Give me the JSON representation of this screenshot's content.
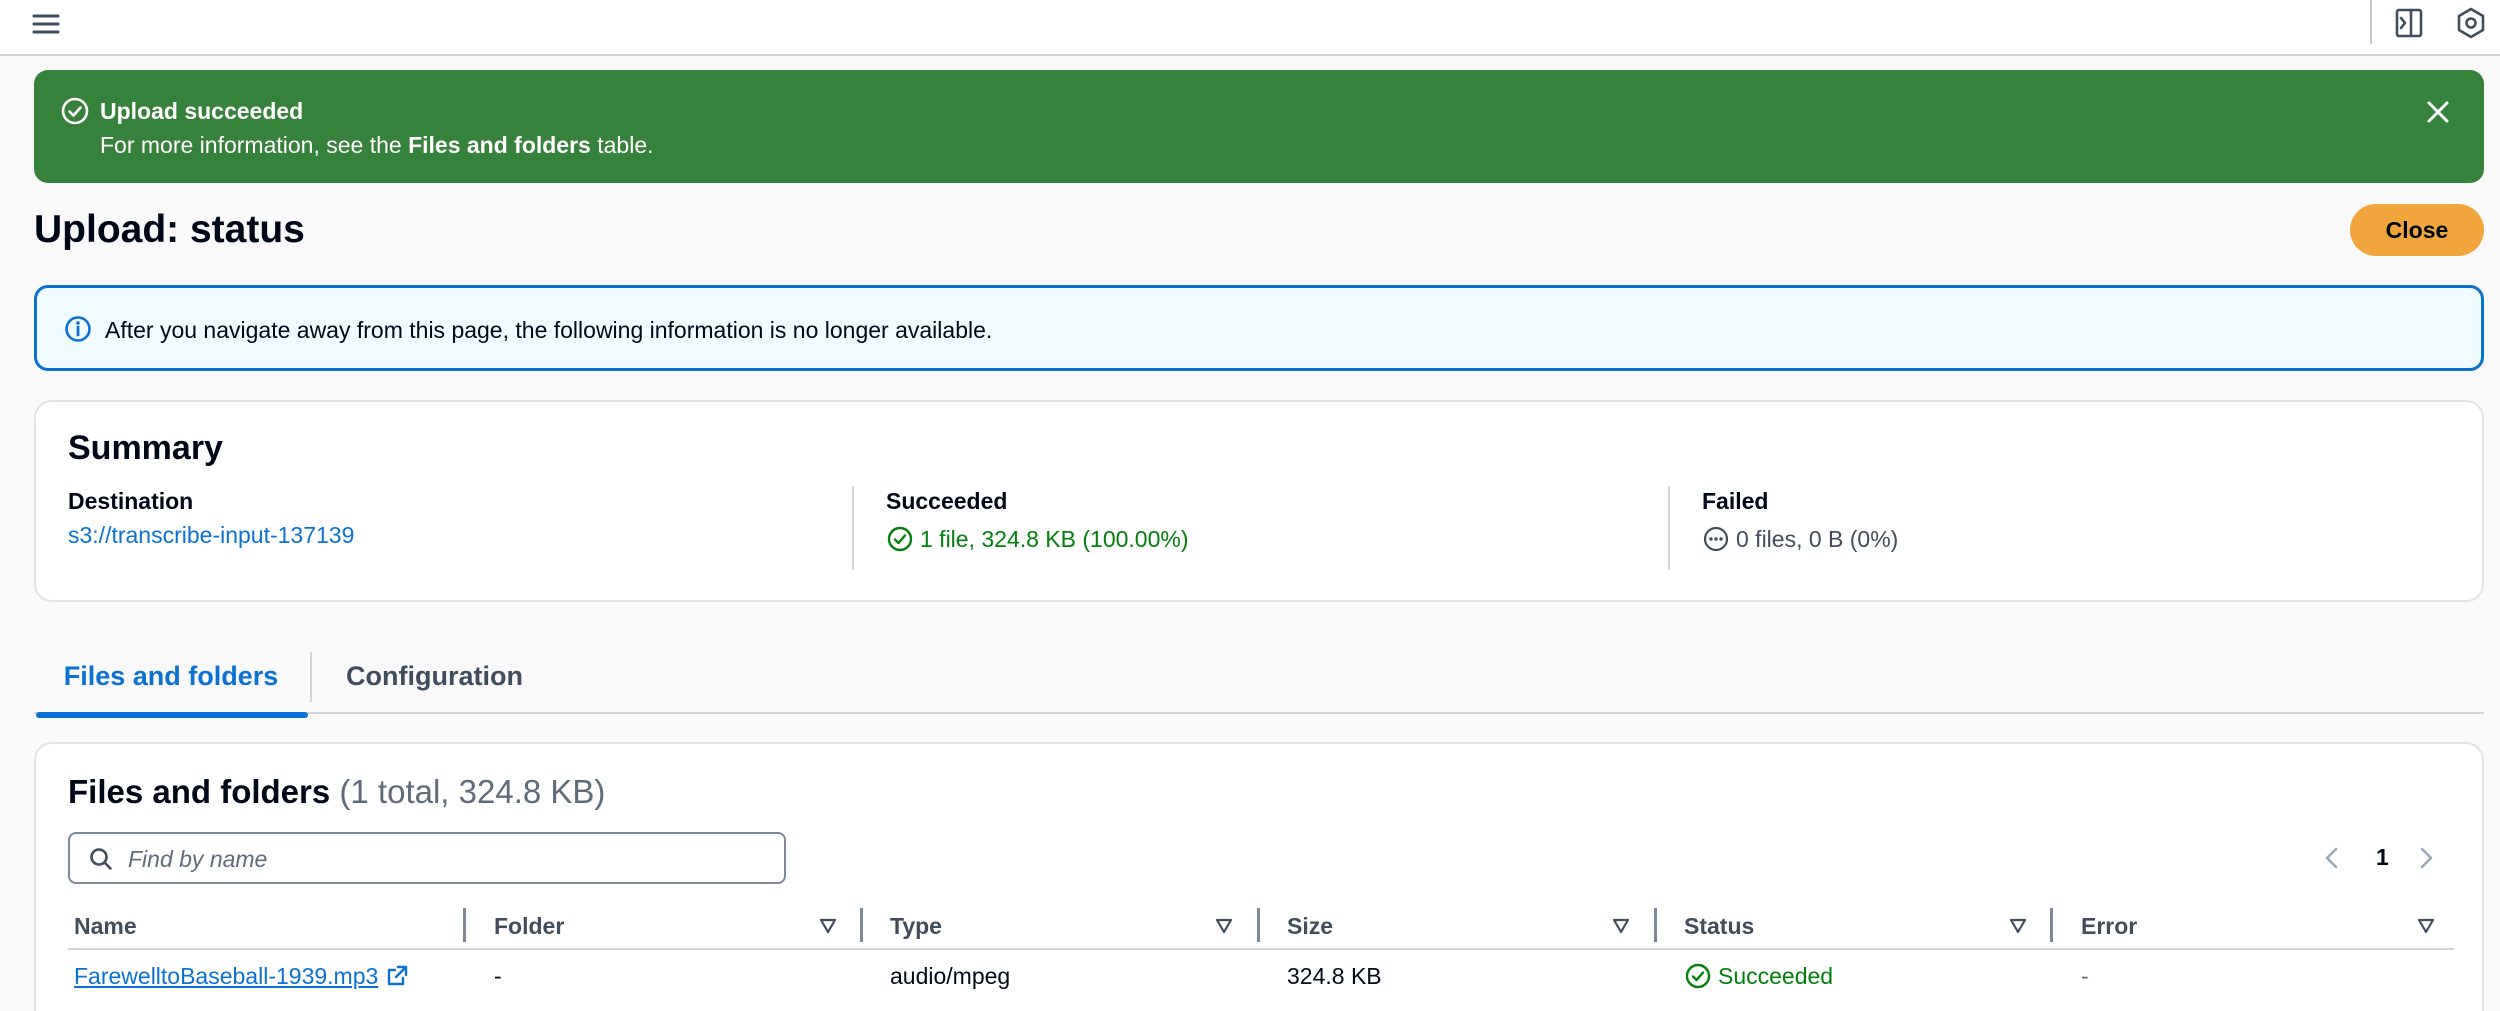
{
  "colors": {
    "success_green": "#37823b",
    "link_blue": "#0972d3",
    "primary_orange": "#f1a53b",
    "status_green": "#037f0c"
  },
  "topbar": {
    "icons": [
      "hamburger-menu-icon",
      "side-panel-icon",
      "settings-hexagon-icon"
    ]
  },
  "flash": {
    "title": "Upload succeeded",
    "message_prefix": "For more information, see the ",
    "message_bold": "Files and folders",
    "message_suffix": " table."
  },
  "header": {
    "title": "Upload: status",
    "close_label": "Close"
  },
  "info": {
    "text": "After you navigate away from this page, the following information is no longer available."
  },
  "summary": {
    "title": "Summary",
    "destination": {
      "label": "Destination",
      "value": "s3://transcribe-input-137139"
    },
    "succeeded": {
      "label": "Succeeded",
      "value": "1 file, 324.8 KB (100.00%)"
    },
    "failed": {
      "label": "Failed",
      "value": "0 files, 0 B (0%)"
    }
  },
  "tabs": [
    {
      "label": "Files and folders",
      "active": true
    },
    {
      "label": "Configuration",
      "active": false
    }
  ],
  "files": {
    "title": "Files and folders",
    "count": "(1 total, 324.8 KB)",
    "search_placeholder": "Find by name",
    "page": "1",
    "columns": [
      "Name",
      "Folder",
      "Type",
      "Size",
      "Status",
      "Error"
    ],
    "rows": [
      {
        "name": "FarewelltoBaseball-1939.mp3",
        "folder": "-",
        "type": "audio/mpeg",
        "size": "324.8 KB",
        "status": "Succeeded",
        "error": "-"
      }
    ]
  }
}
